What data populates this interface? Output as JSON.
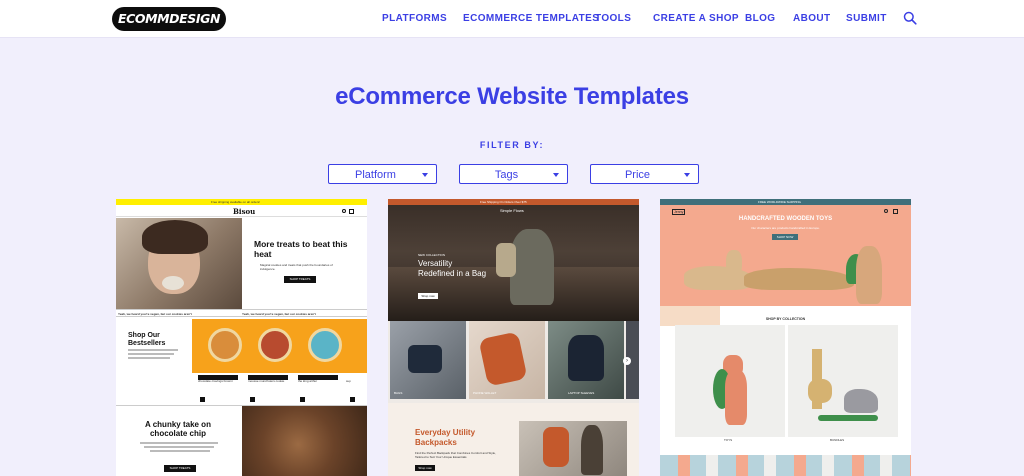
{
  "header": {
    "logo_text": "ECOMMDESIGN",
    "nav": [
      "PLATFORMS",
      "ECOMMERCE TEMPLATES",
      "TOOLS",
      "CREATE A SHOP",
      "BLOG",
      "ABOUT",
      "SUBMIT"
    ],
    "search_icon": "search-icon"
  },
  "page": {
    "title": "eCommerce Website Templates",
    "filter_label": "FILTER BY:",
    "filters": [
      "Platform",
      "Tags",
      "Price"
    ]
  },
  "cards": [
    {
      "announcement": "Free shipping available on all orders!",
      "brand": "Bisou",
      "hero_heading": "More treats to beat this heat",
      "hero_body": "Magical cookies and treats that push the boundaries of indulgence.",
      "hero_button": "SHOP TREATS",
      "ticker": "Yeah, we heard you're vegan, but our cookies aren't",
      "section_heading": "Shop Our Bestsellers",
      "products": [
        "chocolate cravings browni",
        "mousse munchsters cookie",
        "the king arthur",
        "sup"
      ],
      "promo_heading": "A chunky take on chocolate chip",
      "promo_button": "SHOP TREATS"
    },
    {
      "announcement": "Free Shipping On Orders Over $75",
      "brand": "Simple Flows",
      "collection_label": "NEW COLLECTION",
      "hero_heading": "Versatility Redefined in a Bag",
      "hero_button": "Shop now",
      "tiles": [
        "BAGS",
        "PHONE WALLET",
        "LAPTOP SLEEVES"
      ],
      "promo_heading": "Everyday Utility Backpacks",
      "promo_body": "Find the Perfect Backpack that Combines Comfort and Style, Tailored to Suit Your Unique Essentials",
      "promo_button": "Shop now"
    },
    {
      "announcement": "FREE WORLDWIDE SHIPPING",
      "brand": "Jenny",
      "hero_heading": "HANDCRAFTED WOODEN TOYS",
      "hero_body": "Our characters are products handcrafted in Europe.",
      "hero_button": "SHOP NOW",
      "collection_heading": "SHOP BY COLLECTION",
      "collections": [
        "TOYS",
        "BUNDLES"
      ]
    }
  ],
  "colors": {
    "accent": "#3b3fe4",
    "background": "#f1effc",
    "bisou_yellow": "#ffef00",
    "bisou_orange": "#f7a21b",
    "bag_brown": "#c4592c",
    "toy_peach": "#f4a98e"
  }
}
